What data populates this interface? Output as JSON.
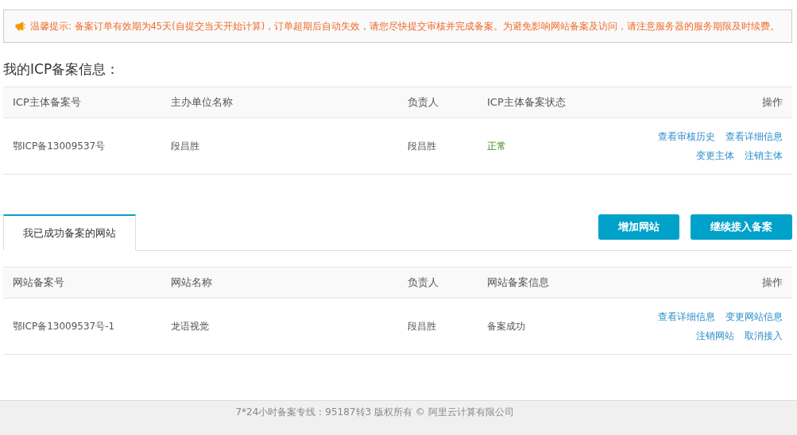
{
  "notice": {
    "text": "温馨提示: 备案订单有效期为45天(自提交当天开始计算)，订单超期后自动失效，请您尽快提交审核并完成备案。为避免影响网站备案及访问，请注意服务器的服务期限及时续费。"
  },
  "heading": "我的ICP备案信息：",
  "icp_table": {
    "columns": [
      "ICP主体备案号",
      "主办单位名称",
      "负责人",
      "ICP主体备案状态",
      "操作"
    ],
    "rows": [
      {
        "cells": [
          {
            "kind": "text",
            "text": "鄂ICP备13009537号"
          },
          {
            "kind": "text",
            "text": "段昌胜"
          },
          {
            "kind": "text",
            "text": "段昌胜"
          },
          {
            "kind": "status",
            "text": "正常"
          }
        ],
        "actions": [
          [
            "查看审核历史",
            "查看详细信息"
          ],
          [
            "变更主体",
            "注销主体"
          ]
        ]
      }
    ]
  },
  "tabs": [
    {
      "label": "我已成功备案的网站",
      "selected": true
    }
  ],
  "buttons": [
    "增加网站",
    "继续接入备案"
  ],
  "site_table": {
    "columns": [
      "网站备案号",
      "网站名称",
      "负责人",
      "网站备案信息",
      "操作"
    ],
    "rows": [
      {
        "cells": [
          {
            "kind": "text",
            "text": "鄂ICP备13009537号-1"
          },
          {
            "kind": "text",
            "text": "龙语视觉"
          },
          {
            "kind": "text",
            "text": "段昌胜"
          },
          {
            "kind": "text",
            "text": "备案成功"
          }
        ],
        "actions": [
          [
            "查看详细信息",
            "变更网站信息"
          ],
          [
            "注销网站",
            "取消接入"
          ]
        ]
      }
    ]
  },
  "footer": "7*24小时备案专线：95187转3 版权所有 © 阿里云计算有限公司"
}
